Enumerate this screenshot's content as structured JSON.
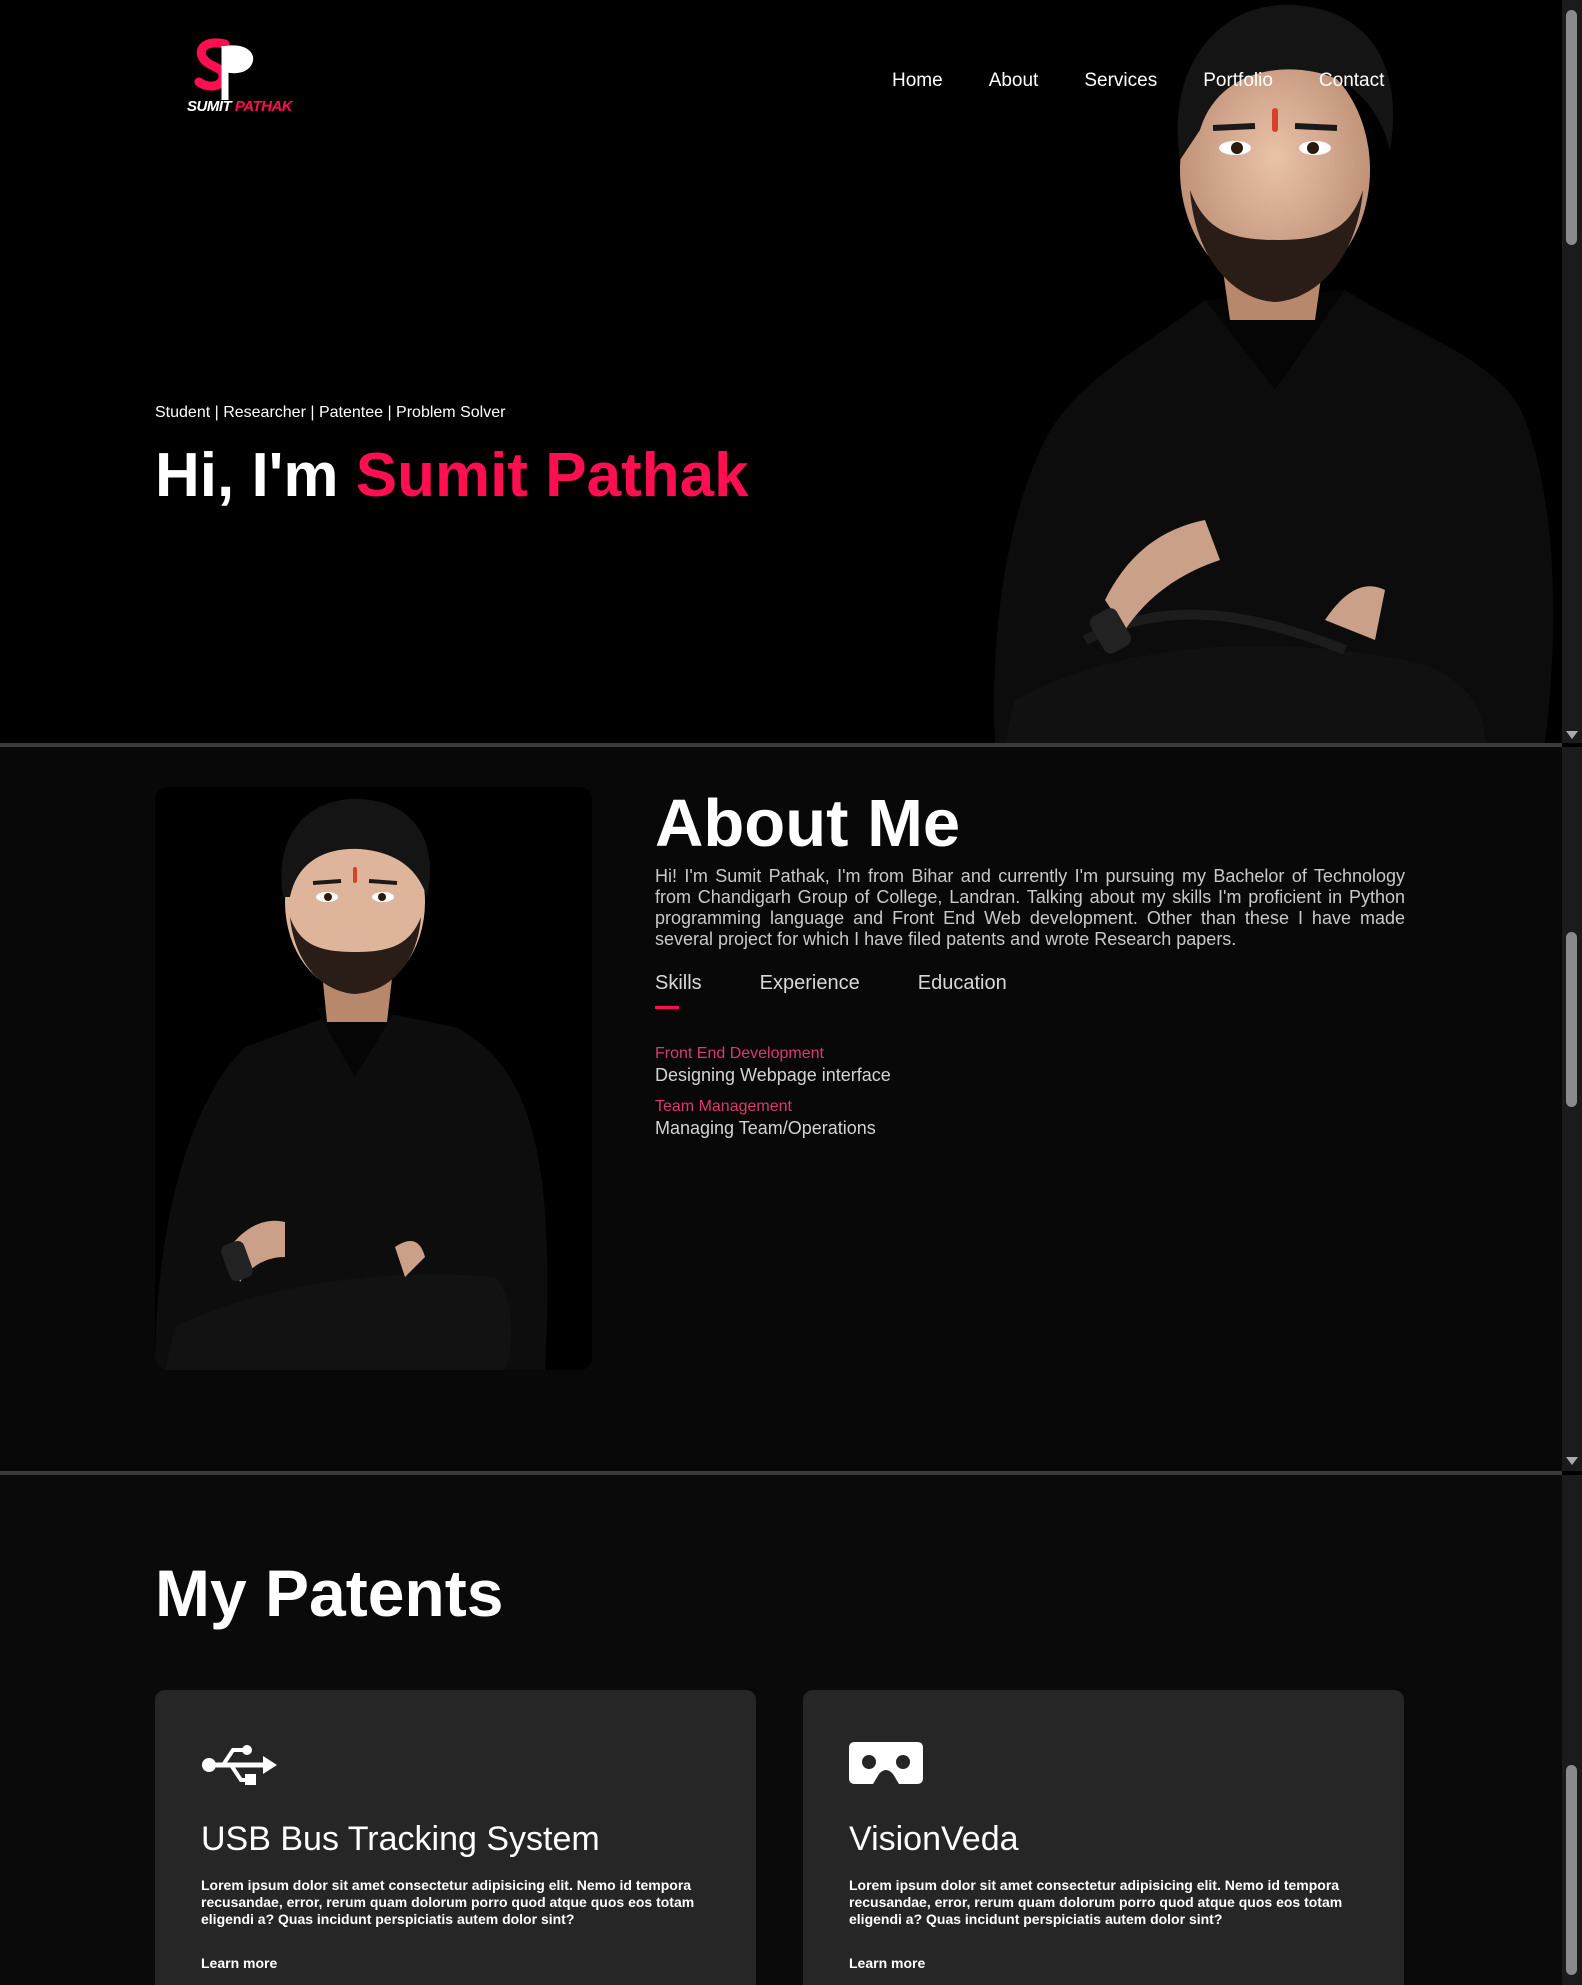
{
  "brand": {
    "first_name": "SUMIT",
    "last_name": "PATHAK",
    "accent_color": "#ff0f50"
  },
  "nav": {
    "items": [
      "Home",
      "About",
      "Services",
      "Portfolio",
      "Contact"
    ]
  },
  "hero": {
    "tagline": "Student | Researcher | Patentee | Problem Solver",
    "greeting": "Hi, I'm ",
    "name": "Sumit Pathak"
  },
  "about": {
    "title": "About Me",
    "text": "Hi! I'm Sumit Pathak, I'm from Bihar and currently I'm pursuing my Bachelor of Technology from Chandigarh Group of College, Landran. Talking about my skills I'm proficient in Python programming language and Front End Web development. Other than these I have made several project for which I have filed patents and wrote Research papers.",
    "tabs": [
      "Skills",
      "Experience",
      "Education"
    ],
    "active_tab": "Skills",
    "skills": [
      {
        "name": "Front End Development",
        "desc": "Designing Webpage interface"
      },
      {
        "name": "Team Management",
        "desc": "Managing Team/Operations"
      }
    ]
  },
  "patents": {
    "title": "My Patents",
    "cards": [
      {
        "icon": "usb-icon",
        "title": "USB Bus Tracking System",
        "text": "Lorem ipsum dolor sit amet consectetur adipisicing elit. Nemo id tempora recusandae, error, rerum quam dolorum porro quod atque quos eos totam eligendi a? Quas incidunt perspiciatis autem dolor sint?",
        "link": "Learn more"
      },
      {
        "icon": "vr-headset-icon",
        "title": "VisionVeda",
        "text": "Lorem ipsum dolor sit amet consectetur adipisicing elit. Nemo id tempora recusandae, error, rerum quam dolorum porro quod atque quos eos totam eligendi a? Quas incidunt perspiciatis autem dolor sint?",
        "link": "Learn more"
      }
    ]
  }
}
